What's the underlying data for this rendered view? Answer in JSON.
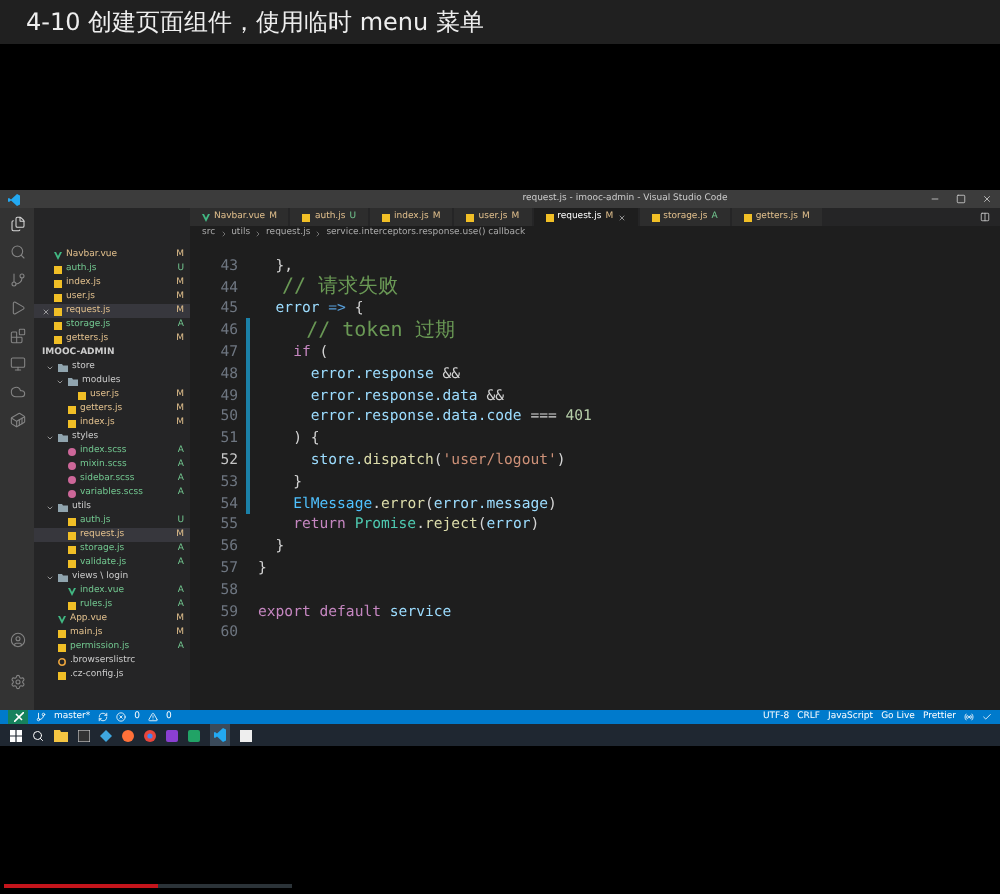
{
  "video": {
    "title": "4-10 创建页面组件，使用临时 menu 菜单",
    "progress": {
      "level": 0.156
    }
  },
  "editor": {
    "window_title": "request.js - imooc-admin - Visual Studio Code",
    "tabs": [
      {
        "label": "Navbar.vue",
        "kind": "vue",
        "status": "M",
        "selected": false
      },
      {
        "label": "auth.js",
        "kind": "js",
        "status": "U",
        "selected": false
      },
      {
        "label": "index.js",
        "kind": "js",
        "status": "M",
        "selected": false
      },
      {
        "label": "user.js",
        "kind": "js",
        "status": "M",
        "selected": false
      },
      {
        "label": "request.js",
        "kind": "js",
        "status": "M",
        "selected": true
      },
      {
        "label": "storage.js",
        "kind": "js",
        "status": "A",
        "selected": false
      },
      {
        "label": "getters.js",
        "kind": "js",
        "status": "M",
        "selected": false
      }
    ],
    "breadcrumb": [
      "src",
      "utils",
      "request.js",
      "service.interceptors.response.use() callback"
    ],
    "open_editors": [
      {
        "name": "Navbar.vue",
        "kind": "vue",
        "status": "M",
        "selected": false
      },
      {
        "name": "auth.js",
        "kind": "js",
        "status": "U",
        "selected": false
      },
      {
        "name": "index.js",
        "kind": "js",
        "status": "M",
        "selected": false
      },
      {
        "name": "user.js",
        "kind": "js",
        "status": "M",
        "selected": false
      },
      {
        "name": "request.js",
        "kind": "js",
        "status": "M",
        "selected": true
      },
      {
        "name": "storage.js",
        "kind": "js",
        "status": "A",
        "selected": false
      },
      {
        "name": "getters.js",
        "kind": "js",
        "status": "M",
        "selected": false
      }
    ],
    "project": "IMOOC-ADMIN",
    "tree": [
      {
        "name": "store",
        "kind": "folder",
        "expanded": true,
        "children": [
          {
            "name": "modules",
            "kind": "folder",
            "expanded": true,
            "children": [
              {
                "name": "user.js",
                "kind": "js",
                "status": "M",
                "selected": false
              }
            ]
          },
          {
            "name": "getters.js",
            "kind": "js",
            "status": "M",
            "selected": false
          },
          {
            "name": "index.js",
            "kind": "js",
            "status": "M",
            "selected": false
          }
        ]
      },
      {
        "name": "styles",
        "kind": "folder",
        "expanded": true,
        "children": [
          {
            "name": "index.scss",
            "kind": "scss",
            "status": "A",
            "selected": false
          },
          {
            "name": "mixin.scss",
            "kind": "scss",
            "status": "A",
            "selected": false
          },
          {
            "name": "sidebar.scss",
            "kind": "scss",
            "status": "A",
            "selected": false
          },
          {
            "name": "variables.scss",
            "kind": "scss",
            "status": "A",
            "selected": false
          }
        ]
      },
      {
        "name": "utils",
        "kind": "folder",
        "expanded": true,
        "children": [
          {
            "name": "auth.js",
            "kind": "js",
            "status": "U",
            "selected": false
          },
          {
            "name": "request.js",
            "kind": "js",
            "status": "M",
            "selected": true
          },
          {
            "name": "storage.js",
            "kind": "js",
            "status": "A",
            "selected": false
          },
          {
            "name": "validate.js",
            "kind": "js",
            "status": "A",
            "selected": false
          }
        ]
      },
      {
        "name": "views \\ login",
        "kind": "folder",
        "expanded": true,
        "children": [
          {
            "name": "index.vue",
            "kind": "vue",
            "status": "A",
            "selected": false
          },
          {
            "name": "rules.js",
            "kind": "js",
            "status": "A",
            "selected": false
          }
        ]
      },
      {
        "name": "App.vue",
        "kind": "vue",
        "status": "M",
        "selected": false
      },
      {
        "name": "main.js",
        "kind": "js",
        "status": "M",
        "selected": false
      },
      {
        "name": "permission.js",
        "kind": "js",
        "status": "A",
        "selected": false
      },
      {
        "name": ".browserslistrc",
        "kind": "config",
        "selected": false
      },
      {
        "name": ".cz-config.js",
        "kind": "js",
        "selected": false
      }
    ],
    "code": [
      {
        "number": "43",
        "current": false,
        "modified": false,
        "tokens": [
          {
            "kind": "punct",
            "text": "  },"
          }
        ]
      },
      {
        "number": "44",
        "current": false,
        "modified": false,
        "tokens": [
          {
            "kind": "comment",
            "text": "  // 请求失败"
          }
        ]
      },
      {
        "number": "45",
        "current": false,
        "modified": false,
        "tokens": [
          {
            "kind": "var",
            "text": "  error "
          },
          {
            "kind": "arrow",
            "text": "=>"
          },
          {
            "kind": "punct",
            "text": " {"
          }
        ]
      },
      {
        "number": "46",
        "current": false,
        "modified": true,
        "tokens": [
          {
            "kind": "comment",
            "text": "    // token 过期"
          }
        ]
      },
      {
        "number": "47",
        "current": false,
        "modified": true,
        "tokens": [
          {
            "kind": "keyword",
            "text": "    if"
          },
          {
            "kind": "punct",
            "text": " ("
          }
        ]
      },
      {
        "number": "48",
        "current": false,
        "modified": true,
        "tokens": [
          {
            "kind": "var",
            "text": "      error.response "
          },
          {
            "kind": "punct",
            "text": "&&"
          }
        ]
      },
      {
        "number": "49",
        "current": false,
        "modified": true,
        "tokens": [
          {
            "kind": "var",
            "text": "      error.response.data "
          },
          {
            "kind": "punct",
            "text": "&&"
          }
        ]
      },
      {
        "number": "50",
        "current": false,
        "modified": true,
        "tokens": [
          {
            "kind": "var",
            "text": "      error.response.data.code "
          },
          {
            "kind": "punct",
            "text": "=== "
          },
          {
            "kind": "number",
            "text": "401"
          }
        ]
      },
      {
        "number": "51",
        "current": false,
        "modified": true,
        "tokens": [
          {
            "kind": "punct",
            "text": "    ) {"
          }
        ]
      },
      {
        "number": "52",
        "current": true,
        "modified": true,
        "tokens": [
          {
            "kind": "var",
            "text": "      store."
          },
          {
            "kind": "func",
            "text": "dispatch"
          },
          {
            "kind": "punct",
            "text": "("
          },
          {
            "kind": "string",
            "text": "'user/logout'"
          },
          {
            "kind": "punct",
            "text": ")"
          }
        ]
      },
      {
        "number": "53",
        "current": false,
        "modified": true,
        "tokens": [
          {
            "kind": "punct",
            "text": "    }"
          }
        ]
      },
      {
        "number": "54",
        "current": false,
        "modified": true,
        "tokens": [
          {
            "kind": "class",
            "text": "    ElMessage"
          },
          {
            "kind": "punct",
            "text": "."
          },
          {
            "kind": "func",
            "text": "error"
          },
          {
            "kind": "punct",
            "text": "("
          },
          {
            "kind": "var",
            "text": "error.message"
          },
          {
            "kind": "punct",
            "text": ")"
          }
        ]
      },
      {
        "number": "55",
        "current": false,
        "modified": false,
        "tokens": [
          {
            "kind": "keyword",
            "text": "    return "
          },
          {
            "kind": "type",
            "text": "Promise"
          },
          {
            "kind": "punct",
            "text": "."
          },
          {
            "kind": "func",
            "text": "reject"
          },
          {
            "kind": "punct",
            "text": "("
          },
          {
            "kind": "var",
            "text": "error"
          },
          {
            "kind": "punct",
            "text": ")"
          }
        ]
      },
      {
        "number": "56",
        "current": false,
        "modified": false,
        "tokens": [
          {
            "kind": "punct",
            "text": "  }"
          }
        ]
      },
      {
        "number": "57",
        "current": false,
        "modified": false,
        "tokens": [
          {
            "kind": "punct",
            "text": "}"
          }
        ]
      },
      {
        "number": "58",
        "current": false,
        "modified": false
      },
      {
        "number": "59",
        "current": false,
        "modified": false,
        "tokens": [
          {
            "kind": "keyword",
            "text": "export default "
          },
          {
            "kind": "var",
            "text": "service"
          }
        ]
      },
      {
        "number": "60",
        "current": false,
        "modified": false
      }
    ],
    "status_bar": {
      "branch": "master*",
      "errors": "0",
      "warnings": "0",
      "items": [
        "UTF-8",
        "CRLF",
        "JavaScript",
        "Go Live",
        "Prettier"
      ]
    }
  }
}
